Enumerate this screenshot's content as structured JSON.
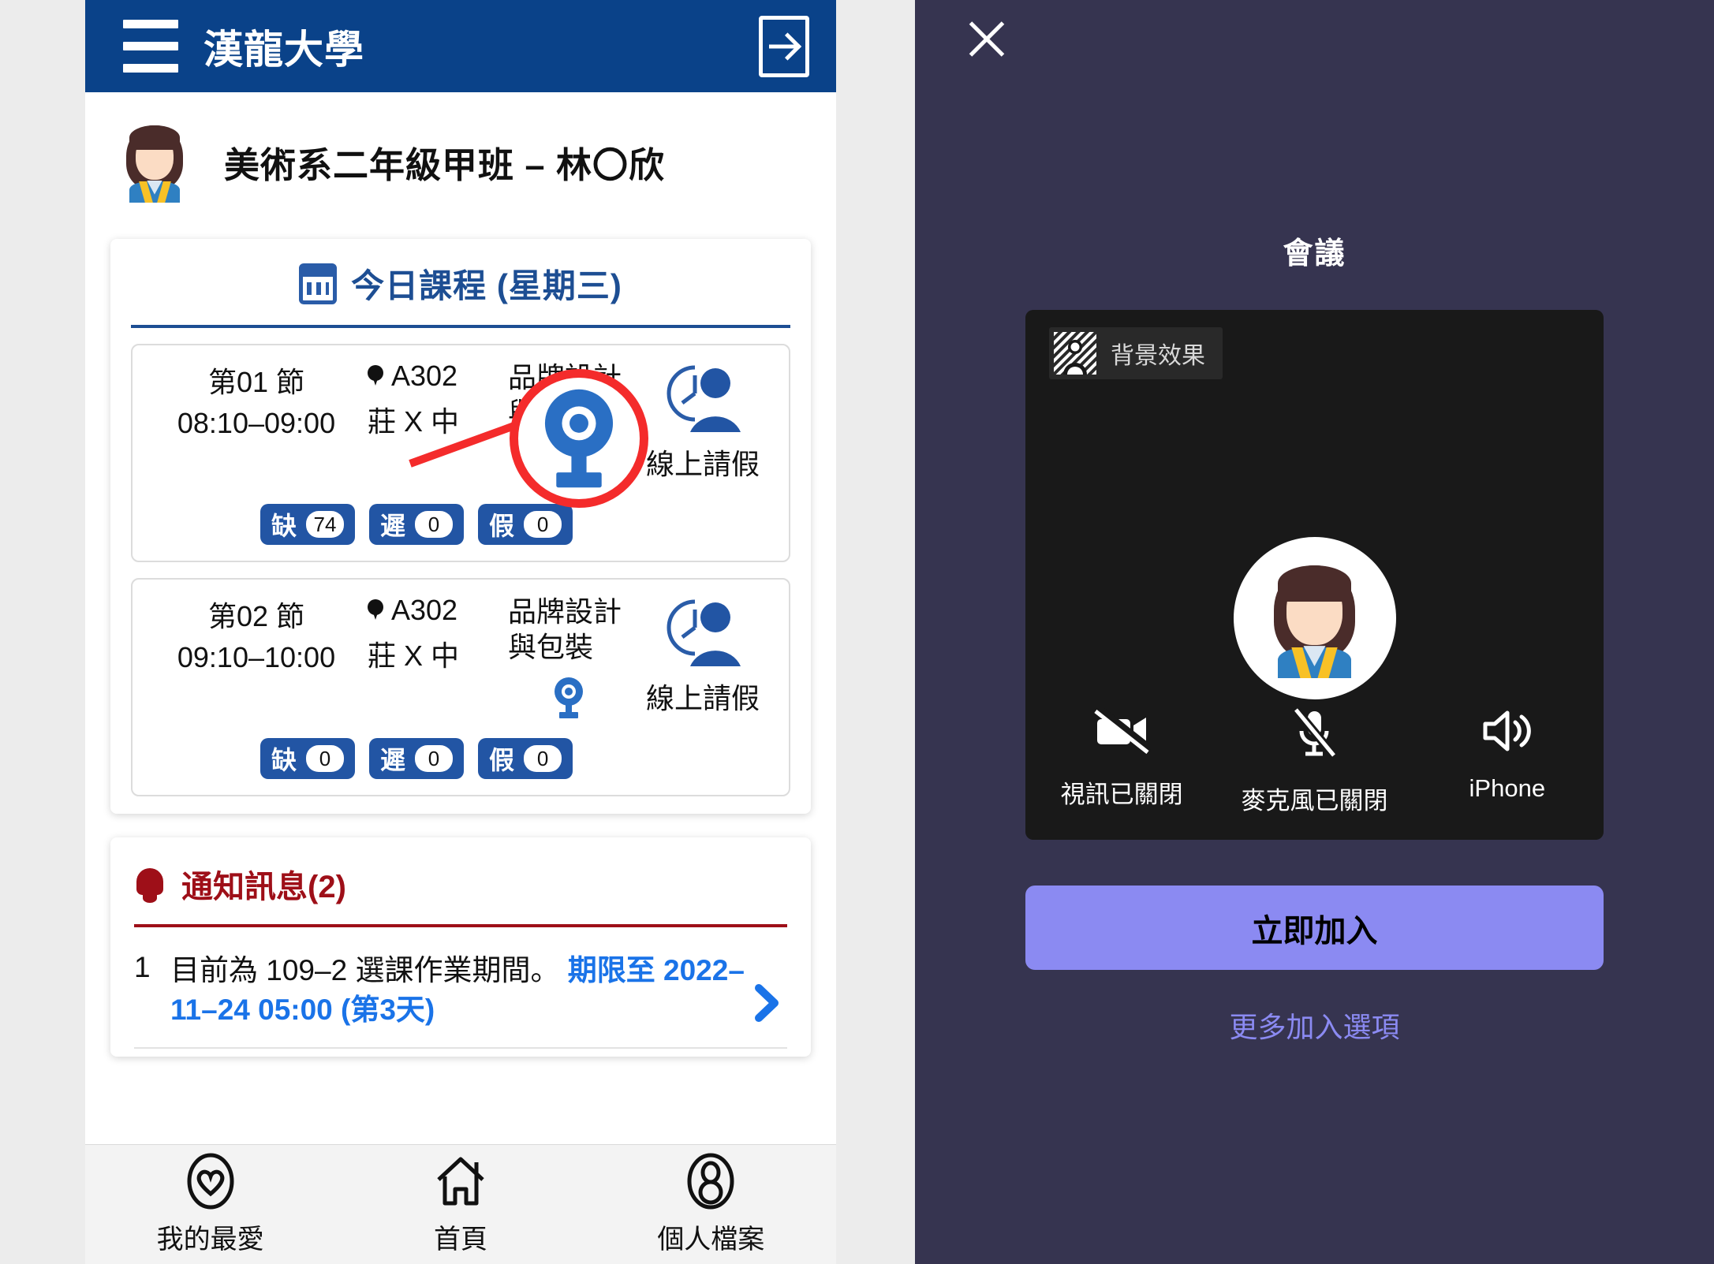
{
  "school_app": {
    "header": {
      "menu_icon": "hamburger-icon",
      "title": "漢龍大學",
      "logout_icon": "logout-arrow-icon"
    },
    "profile": {
      "avatar_icon": "student-avatar",
      "name": "美術系二年級甲班 – 林〇欣"
    },
    "schedule_card": {
      "calendar_icon": "calendar-icon",
      "title": "今日課程 (星期三)",
      "courses": [
        {
          "period": "第01 節",
          "time": "08:10–09:00",
          "location_icon": "map-pin-icon",
          "room": "A302",
          "teacher": "莊 X 中",
          "course_name": "品牌設計與包裝",
          "webcam_icon": "webcam-icon",
          "leave_icon": "clock-person-icon",
          "leave_label": "線上請假",
          "badges": [
            {
              "label": "缺",
              "value": "74"
            },
            {
              "label": "遲",
              "value": "0"
            },
            {
              "label": "假",
              "value": "0"
            }
          ],
          "highlight": true
        },
        {
          "period": "第02 節",
          "time": "09:10–10:00",
          "location_icon": "map-pin-icon",
          "room": "A302",
          "teacher": "莊 X 中",
          "course_name": "品牌設計與包裝",
          "webcam_icon": "webcam-icon",
          "leave_icon": "clock-person-icon",
          "leave_label": "線上請假",
          "badges": [
            {
              "label": "缺",
              "value": "0"
            },
            {
              "label": "遲",
              "value": "0"
            },
            {
              "label": "假",
              "value": "0"
            }
          ],
          "highlight": false
        }
      ]
    },
    "notifications": {
      "bell_icon": "bell-icon",
      "title": "通知訊息(2)",
      "items": [
        {
          "number": "1",
          "text": "目前為 109–2 選課作業期間。",
          "link_text": "期限至 2022–11–24 05:00 (第3天)",
          "chevron_icon": "chevron-right-icon"
        }
      ]
    },
    "bottom_nav": [
      {
        "icon": "heart-icon",
        "label": "我的最愛"
      },
      {
        "icon": "home-icon",
        "label": "首頁"
      },
      {
        "icon": "person-icon",
        "label": "個人檔案"
      }
    ]
  },
  "meeting_app": {
    "close_icon": "close-x-icon",
    "title": "會議",
    "video_preview": {
      "background_effects_icon": "background-effects-icon",
      "background_effects_label": "背景效果",
      "avatar_icon": "student-avatar",
      "controls": [
        {
          "icon": "video-off-icon",
          "label": "視訊已關閉"
        },
        {
          "icon": "mic-off-icon",
          "label": "麥克風已關閉"
        },
        {
          "icon": "speaker-icon",
          "label": "iPhone"
        }
      ]
    },
    "join_button": "立即加入",
    "more_options": "更多加入選項"
  },
  "colors": {
    "header_blue": "#0a4289",
    "accent_blue": "#1d4e93",
    "badge_blue": "#2255a4",
    "link_blue": "#1a73e8",
    "notif_red": "#9e0f18",
    "callout_red": "#f42b2b",
    "meeting_bg": "#363450",
    "join_purple": "#8b8af2",
    "video_bg": "#191919"
  }
}
